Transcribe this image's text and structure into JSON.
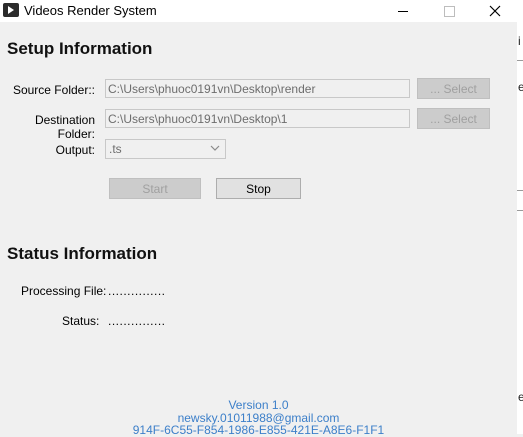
{
  "window": {
    "title": "Videos Render System",
    "controls": {
      "minimize": "minimize",
      "maximize": "maximize",
      "close": "close"
    }
  },
  "setup": {
    "heading": "Setup Information",
    "source": {
      "label": "Source Folder::",
      "value": "C:\\Users\\phuoc0191vn\\Desktop\\render",
      "button": "... Select"
    },
    "destination": {
      "label": "Destination Folder:",
      "value": "C:\\Users\\phuoc0191vn\\Desktop\\1",
      "button": "... Select"
    },
    "output": {
      "label": "Output:",
      "selected": ".ts"
    },
    "start_button": "Start",
    "stop_button": "Stop"
  },
  "status": {
    "heading": "Status Information",
    "processing_file": {
      "label": "Processing File:",
      "value": "..............."
    },
    "status": {
      "label": "Status:",
      "value": "..............."
    }
  },
  "footer": {
    "version": "Version 1.0",
    "email": "newsky.01011988@gmail.com",
    "key": "914F-6C55-F854-1986-E855-421E-A8E6-F1F1"
  },
  "backdrop": {
    "fragments": [
      "i",
      "e",
      "e"
    ]
  },
  "colors": {
    "footer_text": "#3c7fc9",
    "window_bg": "#f0f0f0"
  }
}
